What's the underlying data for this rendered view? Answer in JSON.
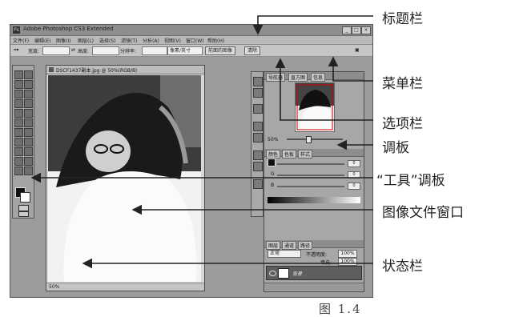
{
  "screenshot": {
    "title": "Adobe Photoshop CS3 Extended",
    "menus": [
      "文件(F)",
      "编辑(E)",
      "图像(I)",
      "图层(L)",
      "选择(S)",
      "滤镜(T)",
      "分析(A)",
      "视图(V)",
      "窗口(W)",
      "帮助(H)"
    ],
    "options": {
      "width_label": "宽度:",
      "height_label": "高度:",
      "resolution_label": "分辨率:",
      "unit_value": "像素/英寸",
      "front_image_button": "前面的图像",
      "clear_button": "清除"
    },
    "document": {
      "tab_title": "DSCF1437副本.jpg @ 50%(RGB/8)",
      "zoom": "50%"
    },
    "panels": {
      "top_tabs": [
        "导航器",
        "直方图",
        "信息"
      ],
      "navigator_zoom": "50%",
      "color_tabs": [
        "颜色",
        "色板",
        "样式"
      ],
      "color_channels": [
        "R",
        "G",
        "B"
      ],
      "color_values": [
        "0",
        "0",
        "0"
      ],
      "layer_tabs": [
        "图层",
        "通道",
        "路径"
      ],
      "blend_mode": "正常",
      "opacity_label": "不透明度:",
      "opacity_value": "100%",
      "fill_label": "填充:",
      "fill_value": "100%",
      "layer_name": "背景"
    }
  },
  "callouts": {
    "title_bar": "标题栏",
    "menu_bar": "菜单栏",
    "options_bar": "选项栏",
    "panels": "调板",
    "toolbox": "“工具”调板",
    "document_window": "图像文件窗口",
    "status_bar": "状态栏"
  },
  "figure_caption": "图 1.4"
}
